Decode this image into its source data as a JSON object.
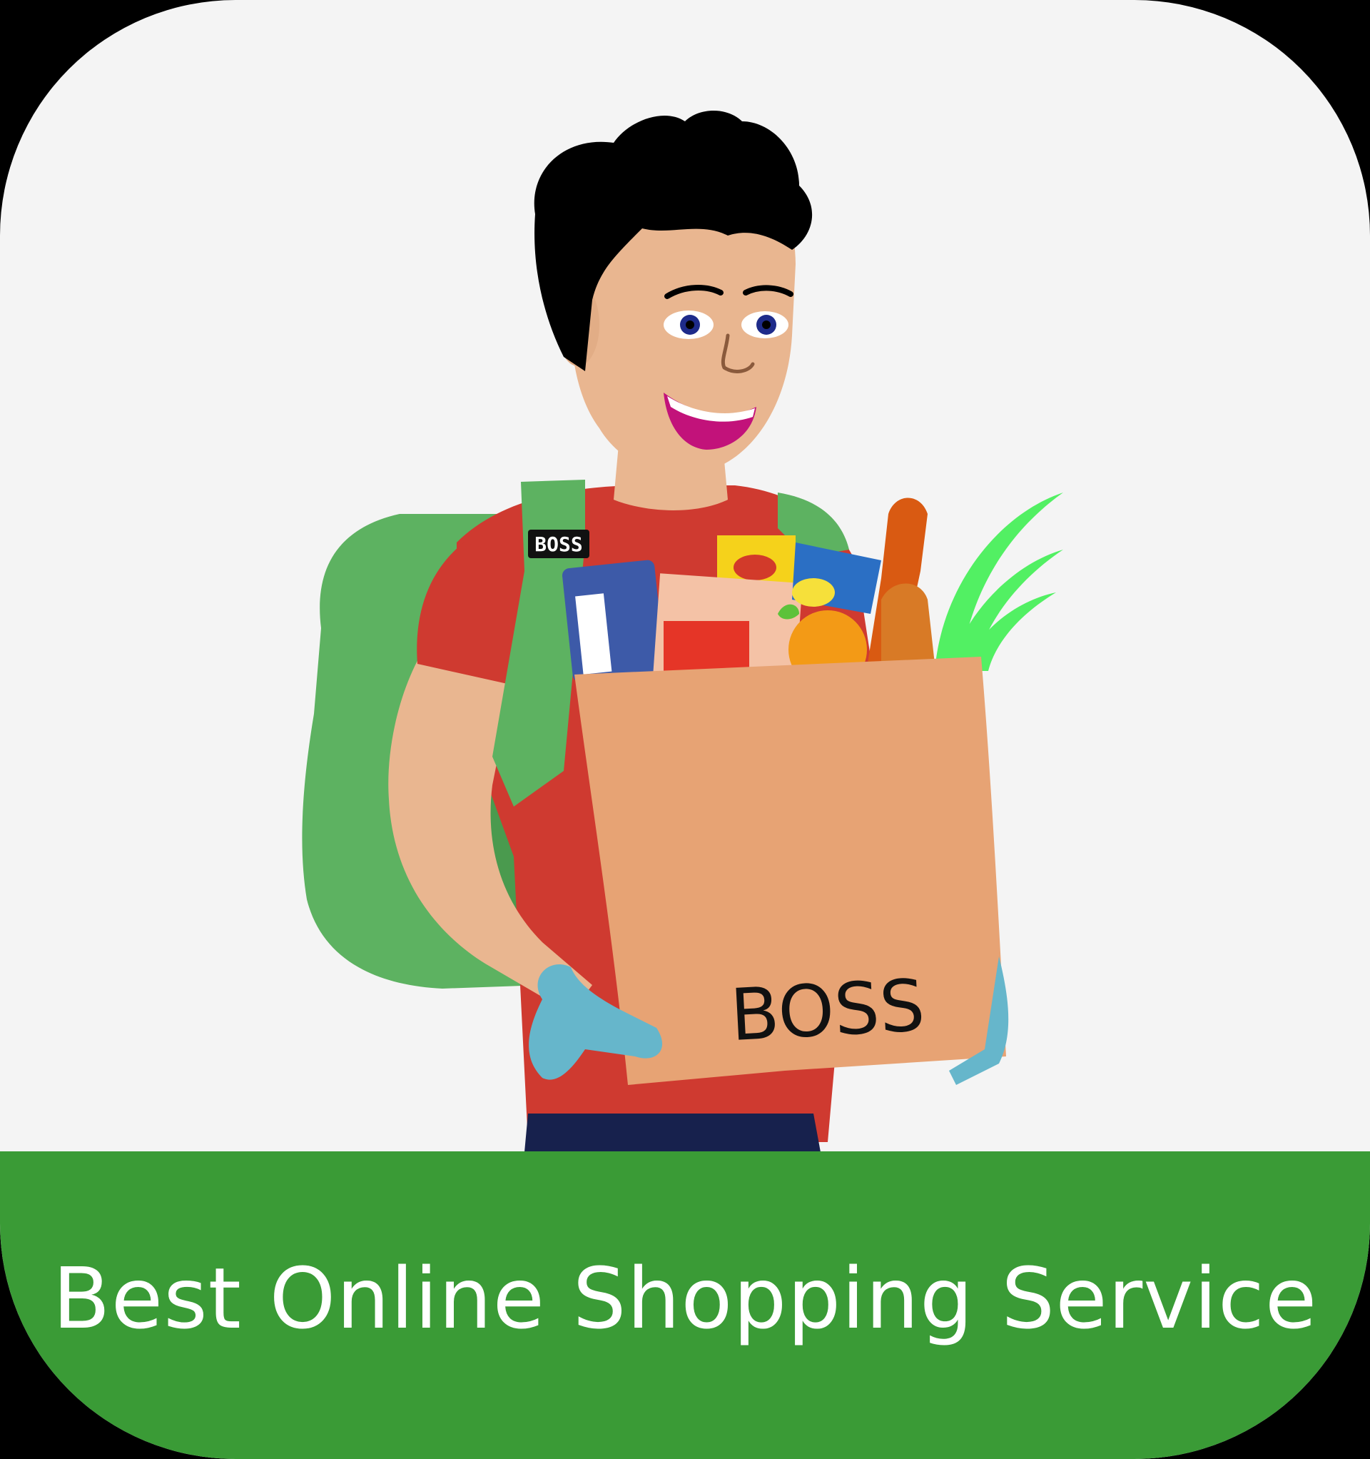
{
  "tagline": "Best Online Shopping Service",
  "brand": {
    "strap_badge": "BOSS",
    "bag_logo": "BOSS"
  },
  "colors": {
    "card_background": "#f4f4f4",
    "footer_green": "#3a9b36",
    "footer_text": "#ffffff",
    "backpack_green": "#5db261",
    "shirt_red": "#cf3a30",
    "bag_tan": "#e7a374",
    "glove_blue": "#66b6cb",
    "skin": "#e9b690",
    "hair": "#000000"
  },
  "illustration": {
    "subject": "delivery-person-holding-grocery-bag",
    "icon": "grocery-delivery-person-icon"
  }
}
